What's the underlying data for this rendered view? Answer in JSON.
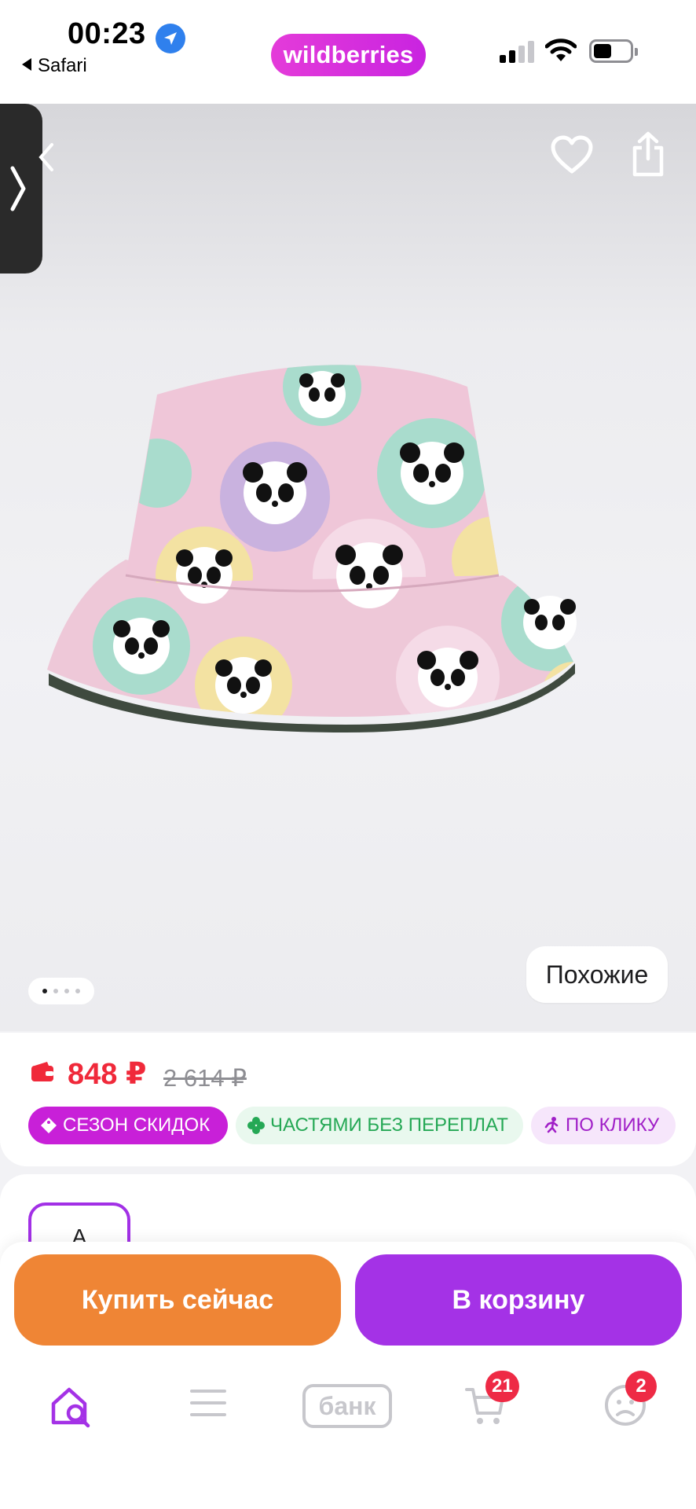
{
  "status_bar": {
    "time": "00:23",
    "back_app": "Safari",
    "brand": "wildberries"
  },
  "gallery": {
    "similar_label": "Похожие",
    "page_count": 4,
    "current_page": 1
  },
  "price": {
    "current": "848 ₽",
    "old": "2 614 ₽",
    "currency_color": "#f0293a"
  },
  "badges": [
    {
      "label": "СЕЗОН СКИДОК",
      "icon": "tag-icon"
    },
    {
      "label": "ЧАСТЯМИ БЕЗ ПЕРЕПЛАТ",
      "icon": "clover-icon"
    },
    {
      "label": "ПО КЛИКУ",
      "icon": "running-man-icon"
    }
  ],
  "options": {
    "size_label": "A"
  },
  "actions": {
    "buy_now": "Купить сейчас",
    "add_to_cart": "В корзину"
  },
  "tab_bar": {
    "bank_label": "банк",
    "cart_count": "21",
    "profile_count": "2"
  },
  "colors": {
    "brand": "#cb26de",
    "buy": "#ef8535",
    "cart": "#a432e6",
    "badge_red": "#ee2a45"
  }
}
